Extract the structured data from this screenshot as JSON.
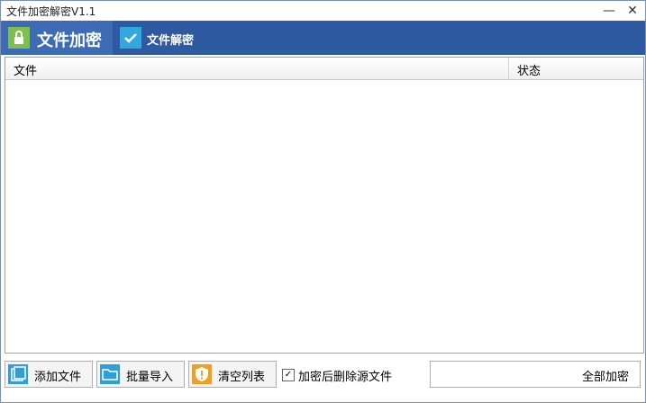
{
  "window": {
    "title": "文件加密解密V1.1",
    "minimize": "—",
    "close": "✕"
  },
  "tabs": {
    "encrypt": "文件加密",
    "decrypt": "文件解密"
  },
  "list": {
    "col_file": "文件",
    "col_status": "状态"
  },
  "toolbar": {
    "add_files": "添加文件",
    "batch_import": "批量导入",
    "clear_list": "清空列表",
    "delete_after": "加密后删除源文件",
    "delete_after_checked": true,
    "encrypt_all": "全部加密"
  },
  "colors": {
    "tab_bar": "#2d5aa0",
    "tab_active": "#3d6cb5",
    "lock_icon": "#7ec050",
    "check_icon": "#31a8e0",
    "folder_icon": "#2e9fd8",
    "warn_icon": "#f0a020"
  }
}
